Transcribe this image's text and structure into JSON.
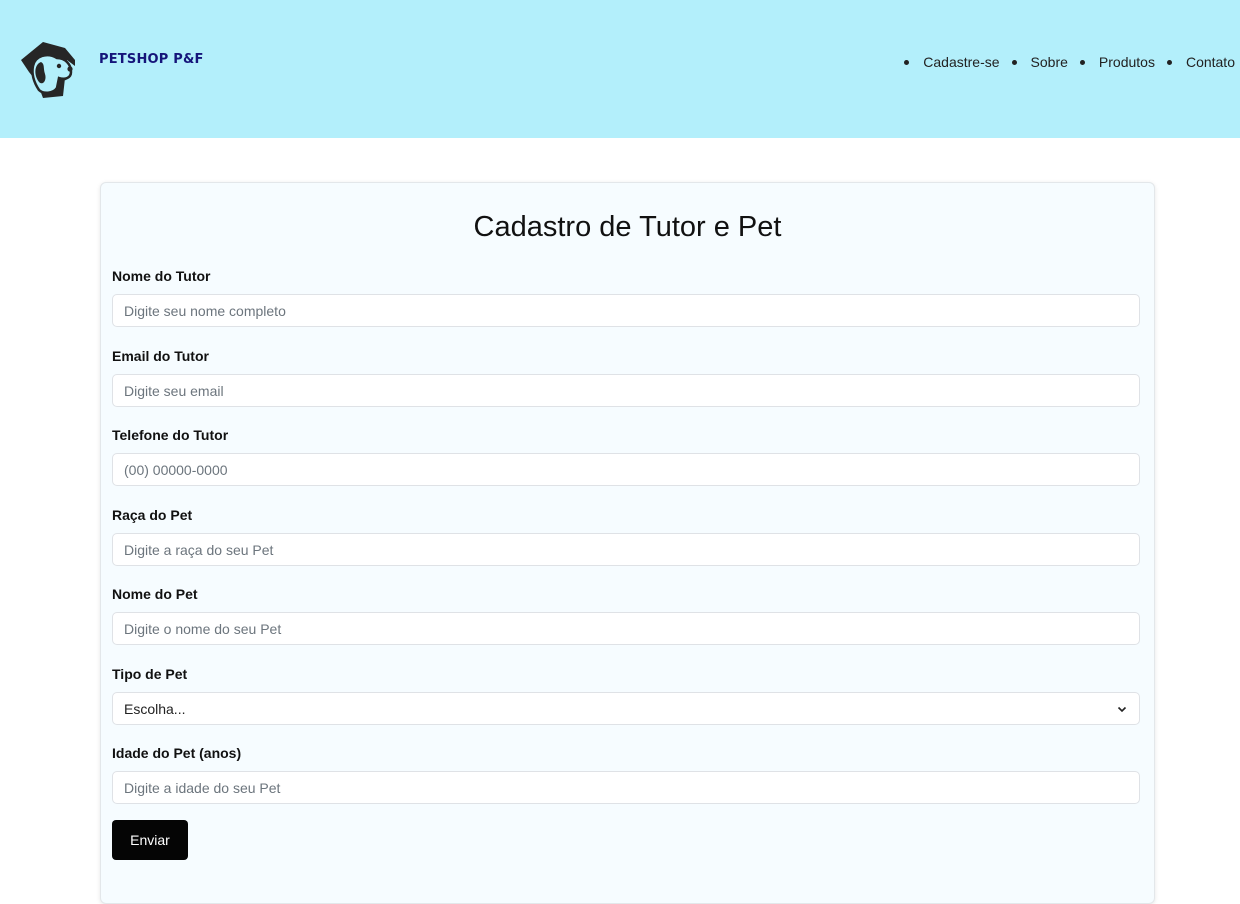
{
  "header": {
    "brand": "PETSHOP P&F",
    "logo_icon": "dog-face-icon",
    "nav": [
      "Cadastre-se",
      "Sobre",
      "Produtos",
      "Contato"
    ]
  },
  "form": {
    "title": "Cadastro de Tutor e Pet",
    "fields": [
      {
        "label": "Nome do Tutor",
        "placeholder": "Digite seu nome completo",
        "value": ""
      },
      {
        "label": "Email do Tutor",
        "placeholder": "Digite seu email",
        "value": ""
      },
      {
        "label": "Telefone do Tutor",
        "placeholder": "(00) 00000-0000",
        "value": ""
      },
      {
        "label": "Raça do Pet",
        "placeholder": "Digite a raça do seu Pet",
        "value": ""
      },
      {
        "label": "Nome do Pet",
        "placeholder": "Digite o nome do seu Pet",
        "value": ""
      },
      {
        "label": "Tipo de Pet",
        "selected": "Escolha..."
      },
      {
        "label": "Idade do Pet (anos)",
        "placeholder": "Digite a idade do seu Pet",
        "value": ""
      }
    ],
    "submit_label": "Enviar"
  },
  "colors": {
    "header_bg": "#b3effb",
    "brand": "#15157a",
    "card_bg": "#f6fcff",
    "button_bg": "#050505"
  }
}
